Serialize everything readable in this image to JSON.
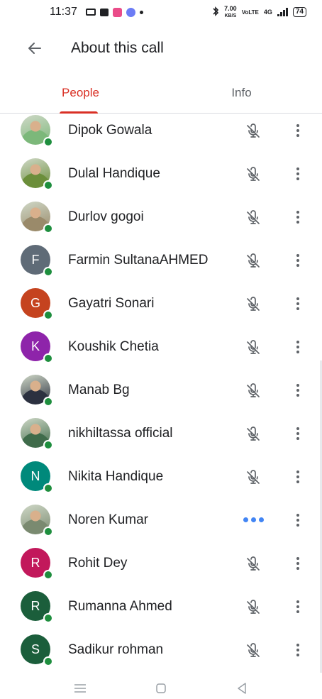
{
  "status_bar": {
    "time": "11:37",
    "speed_value": "7.00",
    "speed_unit": "KB/S",
    "network_label": "VoLTE",
    "network_type": "4G",
    "battery": "74"
  },
  "header": {
    "title": "About this call",
    "back_icon": "arrow-back-icon"
  },
  "tabs": [
    {
      "label": "People",
      "active": true
    },
    {
      "label": "Info",
      "active": false
    }
  ],
  "participants": [
    {
      "name": "Dipok Gowala",
      "avatar": "photo",
      "avatar_color": "#7cb87a",
      "initial": "",
      "audio": "muted"
    },
    {
      "name": "Dulal Handique",
      "avatar": "photo",
      "avatar_color": "#6b8e3a",
      "initial": "",
      "audio": "muted"
    },
    {
      "name": "Durlov gogoi",
      "avatar": "photo",
      "avatar_color": "#9a8a6a",
      "initial": "",
      "audio": "muted"
    },
    {
      "name": "Farmin SultanaAHMED",
      "avatar": "initial",
      "avatar_color": "#5f6b77",
      "initial": "F",
      "audio": "muted"
    },
    {
      "name": "Gayatri Sonari",
      "avatar": "initial",
      "avatar_color": "#c5431f",
      "initial": "G",
      "audio": "muted"
    },
    {
      "name": "Koushik Chetia",
      "avatar": "initial",
      "avatar_color": "#8e24aa",
      "initial": "K",
      "audio": "muted"
    },
    {
      "name": "Manab Bg",
      "avatar": "photo",
      "avatar_color": "#2c3140",
      "initial": "",
      "audio": "muted"
    },
    {
      "name": "nikhiltassa official",
      "avatar": "photo",
      "avatar_color": "#3f6b4a",
      "initial": "",
      "audio": "muted"
    },
    {
      "name": "Nikita Handique",
      "avatar": "initial",
      "avatar_color": "#00897b",
      "initial": "N",
      "audio": "muted"
    },
    {
      "name": "Noren Kumar",
      "avatar": "photo",
      "avatar_color": "#7a8a70",
      "initial": "",
      "audio": "speaking"
    },
    {
      "name": "Rohit Dey",
      "avatar": "initial",
      "avatar_color": "#c2185b",
      "initial": "R",
      "audio": "muted"
    },
    {
      "name": "Rumanna Ahmed",
      "avatar": "initial",
      "avatar_color": "#1b5e3b",
      "initial": "R",
      "audio": "muted"
    },
    {
      "name": "Sadikur rohman",
      "avatar": "initial",
      "avatar_color": "#1b5e3b",
      "initial": "S",
      "audio": "muted"
    }
  ],
  "colors": {
    "accent": "#d93025",
    "online": "#1e8e3e",
    "speaking": "#4285f4"
  },
  "nav_bar": {
    "items": [
      "menu-icon",
      "home-icon",
      "back-icon"
    ]
  }
}
